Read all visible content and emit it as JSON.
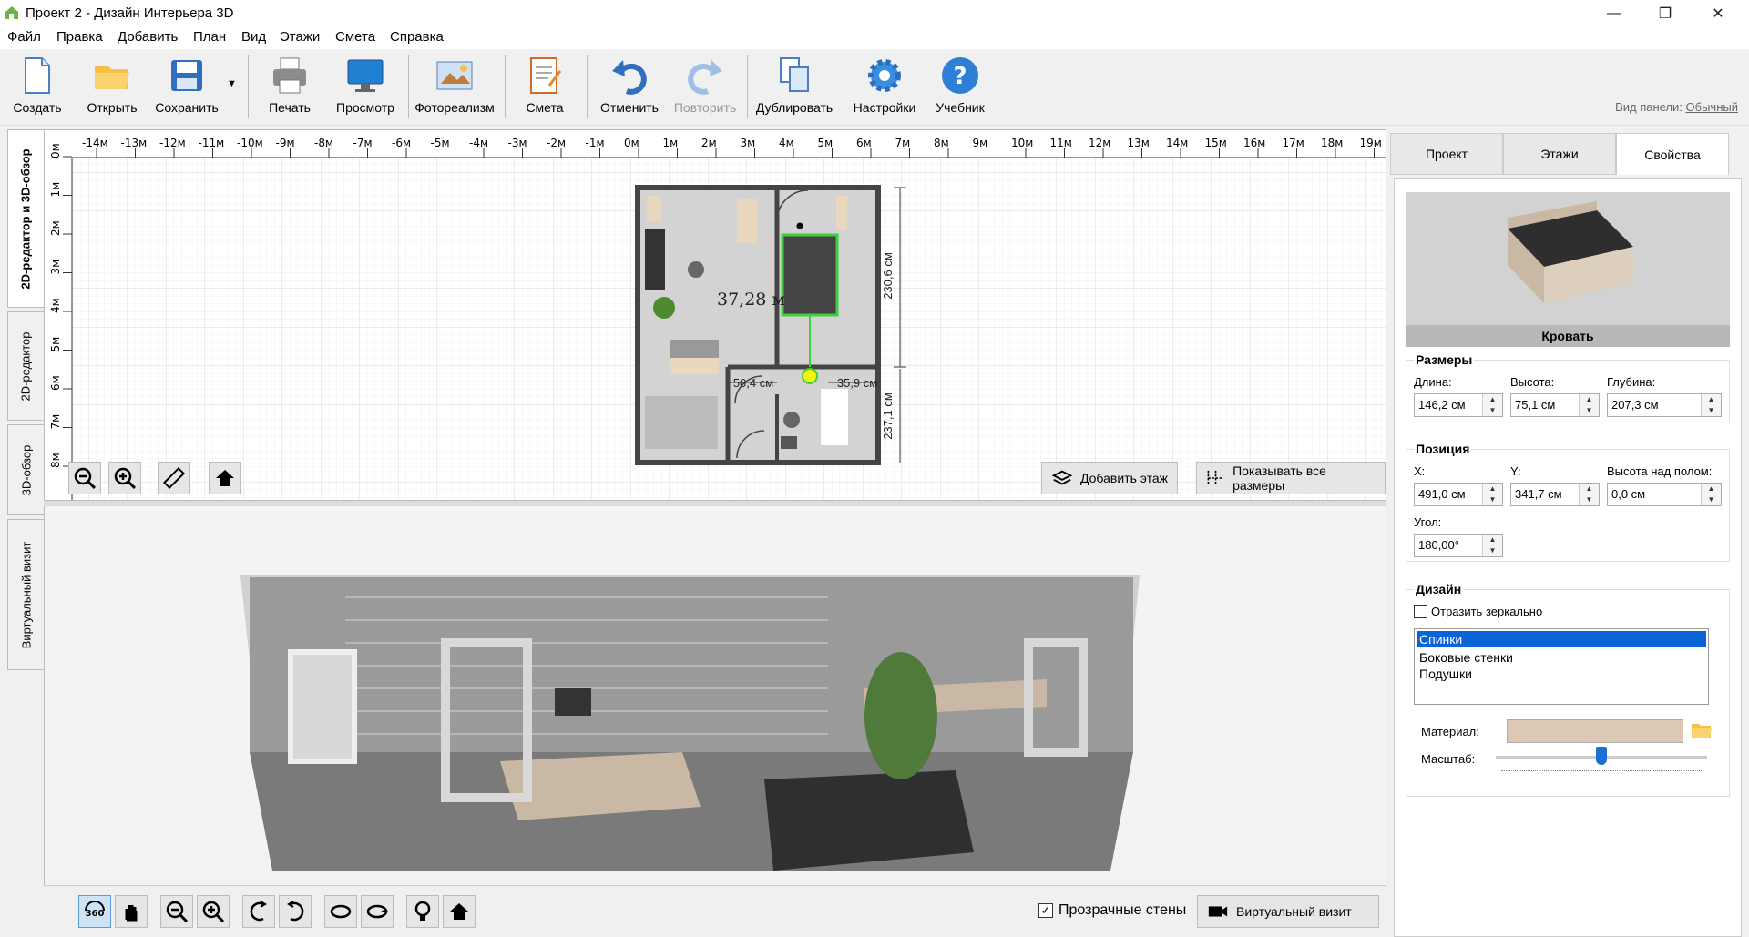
{
  "window": {
    "title": "Проект 2 - Дизайн Интерьера 3D"
  },
  "menu": [
    "Файл",
    "Правка",
    "Добавить",
    "План",
    "Вид",
    "Этажи",
    "Смета",
    "Справка"
  ],
  "toolbar": {
    "create": "Создать",
    "open": "Открыть",
    "save": "Сохранить",
    "print": "Печать",
    "preview": "Просмотр",
    "photo": "Фотореализм",
    "estimate": "Смета",
    "undo": "Отменить",
    "redo": "Повторить",
    "duplicate": "Дублировать",
    "settings": "Настройки",
    "tutorial": "Учебник",
    "panel_view_label": "Вид панели:",
    "panel_view_value": "Обычный"
  },
  "left_tabs": [
    "2D-редактор и 3D-обзор",
    "2D-редактор",
    "3D-обзор",
    "Виртуальный визит"
  ],
  "plan": {
    "ruler_x": [
      "-14м",
      "-13м",
      "-12м",
      "-11м",
      "-10м",
      "-9м",
      "-8м",
      "-7м",
      "-6м",
      "-5м",
      "-4м",
      "-3м",
      "-2м",
      "-1м",
      "0м",
      "1м",
      "2м",
      "3м",
      "4м",
      "5м",
      "6м",
      "7м",
      "8м",
      "9м",
      "10м",
      "11м",
      "12м",
      "13м",
      "14м",
      "15м",
      "16м",
      "17м",
      "18м",
      "19м"
    ],
    "ruler_y": [
      "0м",
      "1м",
      "2м",
      "3м",
      "4м",
      "5м",
      "6м",
      "7м",
      "8м"
    ],
    "area_label": "37,28 м",
    "dim_top_right": "230,6 см",
    "dim_bottom_right": "237,1 см",
    "dim_left_mid": "50,4 см",
    "dim_right_mid": "35,9 см",
    "add_floor": "Добавить этаж",
    "show_dims": "Показывать все размеры"
  },
  "view3d": {
    "transparent_walls": "Прозрачные стены",
    "transparent_checked": true,
    "virtual_visit": "Виртуальный визит"
  },
  "right_tabs": [
    "Проект",
    "Этажи",
    "Свойства"
  ],
  "props": {
    "object_name": "Кровать",
    "sizes_title": "Размеры",
    "length_label": "Длина:",
    "length": "146,2 см",
    "height_label": "Высота:",
    "height": "75,1 см",
    "depth_label": "Глубина:",
    "depth": "207,3 см",
    "position_title": "Позиция",
    "x_label": "X:",
    "x": "491,0 см",
    "y_label": "Y:",
    "y": "341,7 см",
    "elev_label": "Высота над полом:",
    "elev": "0,0 см",
    "angle_label": "Угол:",
    "angle": "180,00°",
    "design_title": "Дизайн",
    "mirror_label": "Отразить зеркально",
    "parts": [
      "Спинки",
      "Боковые стенки",
      "Подушки"
    ],
    "material_label": "Материал:",
    "scale_label": "Масштаб:",
    "scale_level": 0.5
  },
  "colors": {
    "accent": "#0078d7",
    "selection": "#0a64d8",
    "material_swatch": "#dcc8b4"
  }
}
